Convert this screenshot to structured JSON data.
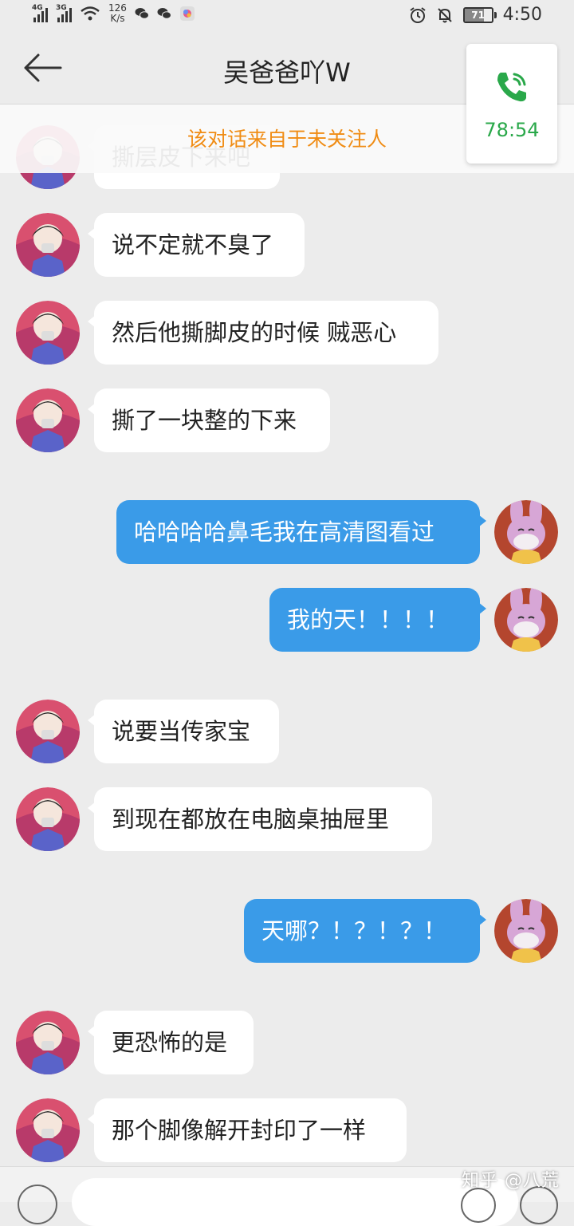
{
  "status_bar": {
    "signal_1_type": "4G",
    "signal_2_type": "3G",
    "net_speed_value": "126",
    "net_speed_unit": "K/s",
    "battery_level": "71",
    "time": "4:50"
  },
  "header": {
    "title": "吴爸爸吖W"
  },
  "notice": "该对话来自于未关注人",
  "call_card": {
    "duration": "78:54"
  },
  "messages": [
    {
      "side": "in",
      "text": "撕层皮下来吧"
    },
    {
      "side": "in",
      "text": "说不定就不臭了"
    },
    {
      "side": "in",
      "text": "然后他撕脚皮的时候 贼恶心"
    },
    {
      "side": "in",
      "text": "撕了一块整的下来"
    },
    {
      "side": "out",
      "text": "哈哈哈哈鼻毛我在高清图看过"
    },
    {
      "side": "out",
      "text": "我的天！！！！"
    },
    {
      "side": "in",
      "text": "说要当传家宝"
    },
    {
      "side": "in",
      "text": "到现在都放在电脑桌抽屉里"
    },
    {
      "side": "out",
      "text": "天哪？！？！？！"
    },
    {
      "side": "in",
      "text": "更恐怖的是"
    },
    {
      "side": "in",
      "text": "那个脚像解开封印了一样"
    }
  ],
  "watermark": "知乎 @八荒",
  "colors": {
    "notice_text": "#f08c14",
    "outgoing_bubble": "#3a9be8",
    "call_green": "#2aa84a",
    "background": "#ececec"
  }
}
